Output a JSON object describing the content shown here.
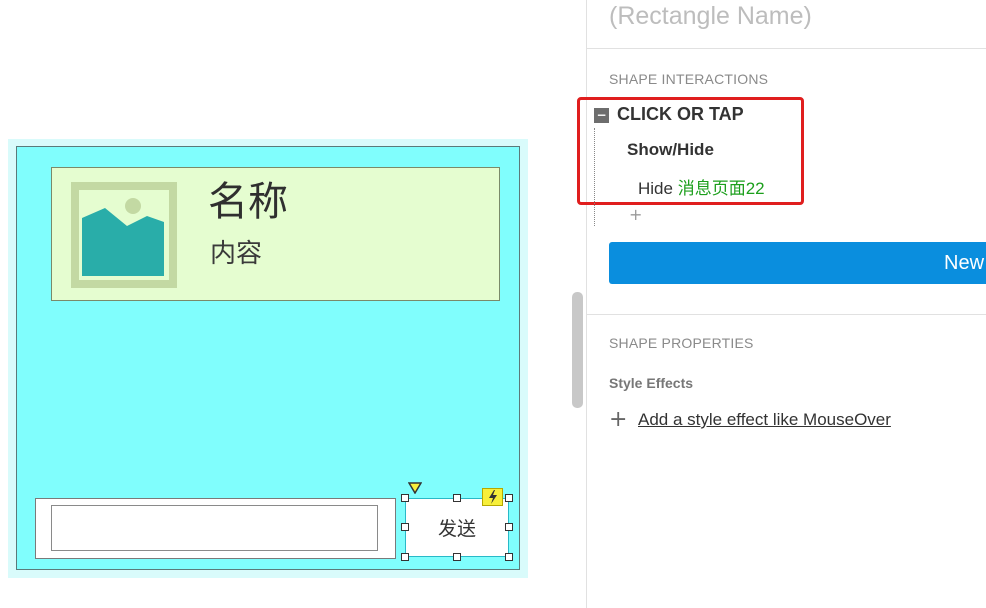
{
  "canvas": {
    "card": {
      "name": "名称",
      "content": "内容"
    },
    "send_button_label": "发送",
    "input_value": "",
    "interaction_flag_icon": "lightning-icon"
  },
  "inspector": {
    "rectangle_name_placeholder": "(Rectangle Name)",
    "shape_interactions": {
      "title": "SHAPE INTERACTIONS",
      "event": {
        "label": "CLICK OR TAP",
        "collapse_symbol": "−"
      },
      "action": {
        "label": "Show/Hide",
        "verb": "Hide",
        "target": "消息页面22"
      },
      "add_action_symbol": "+",
      "new_interaction_label": "New"
    },
    "shape_properties": {
      "title": "SHAPE PROPERTIES",
      "style_effects_label": "Style Effects",
      "add_style_effect_label": "Add a style effect like MouseOver"
    }
  },
  "colors": {
    "panel_fill": "#80fefd",
    "card_fill": "#e5fdd0",
    "highlight_border": "#e01e1e",
    "primary_button": "#0a8ede",
    "target_text": "#1c9f1c"
  }
}
